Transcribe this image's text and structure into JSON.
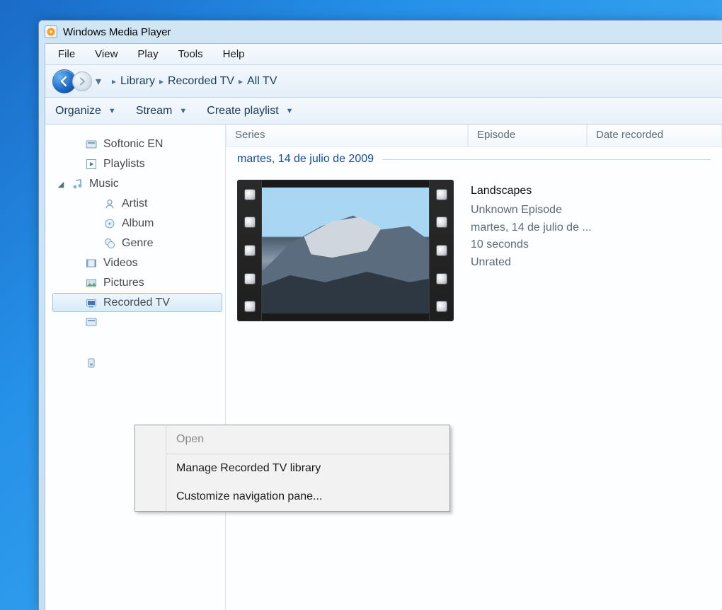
{
  "window": {
    "title": "Windows Media Player"
  },
  "menubar": {
    "file": "File",
    "view": "View",
    "play": "Play",
    "tools": "Tools",
    "help": "Help"
  },
  "breadcrumbs": {
    "b1": "Library",
    "b2": "Recorded TV",
    "b3": "All TV"
  },
  "toolbar": {
    "organize": "Organize",
    "stream": "Stream",
    "create_playlist": "Create playlist"
  },
  "sidebar": {
    "items": [
      {
        "label": "Softonic EN",
        "icon": "library-icon"
      },
      {
        "label": "Playlists",
        "icon": "playlist-icon"
      },
      {
        "label": "Music",
        "icon": "music-icon"
      },
      {
        "label": "Artist",
        "icon": "artist-icon"
      },
      {
        "label": "Album",
        "icon": "album-icon"
      },
      {
        "label": "Genre",
        "icon": "genre-icon"
      },
      {
        "label": "Videos",
        "icon": "videos-icon"
      },
      {
        "label": "Pictures",
        "icon": "pictures-icon"
      },
      {
        "label": "Recorded TV",
        "icon": "recordedtv-icon"
      }
    ]
  },
  "columns": {
    "series": "Series",
    "episode": "Episode",
    "date_recorded": "Date recorded"
  },
  "group": {
    "date": "martes, 14 de julio de 2009"
  },
  "item": {
    "title": "Landscapes",
    "episode": "Unknown Episode",
    "date": "martes, 14 de julio de ...",
    "duration": "10 seconds",
    "rating": "Unrated"
  },
  "context_menu": {
    "open": "Open",
    "manage": "Manage Recorded TV library",
    "customize": "Customize navigation pane..."
  }
}
